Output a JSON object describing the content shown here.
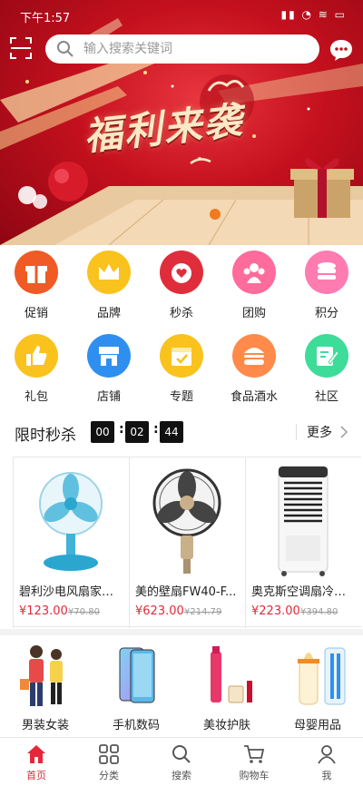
{
  "status_bar": {
    "time": "下午1:57"
  },
  "search": {
    "placeholder": "输入搜索关键词"
  },
  "banner": {
    "title": "福利来袭"
  },
  "categories": [
    {
      "label": "促销",
      "icon": "gift-icon",
      "color": "#f05a24"
    },
    {
      "label": "品牌",
      "icon": "crown-icon",
      "color": "#f9c21d"
    },
    {
      "label": "秒杀",
      "icon": "heart-timer-icon",
      "color": "#e02d3c"
    },
    {
      "label": "团购",
      "icon": "group-icon",
      "color": "#ff6b9a"
    },
    {
      "label": "积分",
      "icon": "coins-icon",
      "color": "#ff7bb0"
    },
    {
      "label": "礼包",
      "icon": "thumbs-up-icon",
      "color": "#f9c21d"
    },
    {
      "label": "店铺",
      "icon": "store-icon",
      "color": "#2f8ff0"
    },
    {
      "label": "专题",
      "icon": "calendar-icon",
      "color": "#f9c21d"
    },
    {
      "label": "食品酒水",
      "icon": "burger-icon",
      "color": "#ff8a4a"
    },
    {
      "label": "社区",
      "icon": "edit-icon",
      "color": "#3ddc98"
    }
  ],
  "flash_sale": {
    "title": "限时秒杀",
    "timer": {
      "hours": "00",
      "minutes": "02",
      "seconds": "44"
    },
    "more_label": "更多",
    "products": [
      {
        "name": "碧利沙电风扇家用...",
        "price": "¥123.00",
        "old_price": "¥70.80"
      },
      {
        "name": "美的壁扇FW40-F...",
        "price": "¥623.00",
        "old_price": "¥214.79"
      },
      {
        "name": "奥克斯空调扇冷暖...",
        "price": "¥223.00",
        "old_price": "¥394.80"
      }
    ]
  },
  "bottom_categories": [
    {
      "label": "男装女装"
    },
    {
      "label": "手机数码"
    },
    {
      "label": "美妆护肤"
    },
    {
      "label": "母婴用品"
    }
  ],
  "tabs": [
    {
      "label": "首页",
      "icon": "home-icon",
      "active": true
    },
    {
      "label": "分类",
      "icon": "grid-icon",
      "active": false
    },
    {
      "label": "搜索",
      "icon": "search-icon",
      "active": false
    },
    {
      "label": "购物车",
      "icon": "cart-icon",
      "active": false
    },
    {
      "label": "我",
      "icon": "user-icon",
      "active": false
    }
  ],
  "colors": {
    "accent": "#e4283a",
    "banner_red": "#c4101e"
  }
}
